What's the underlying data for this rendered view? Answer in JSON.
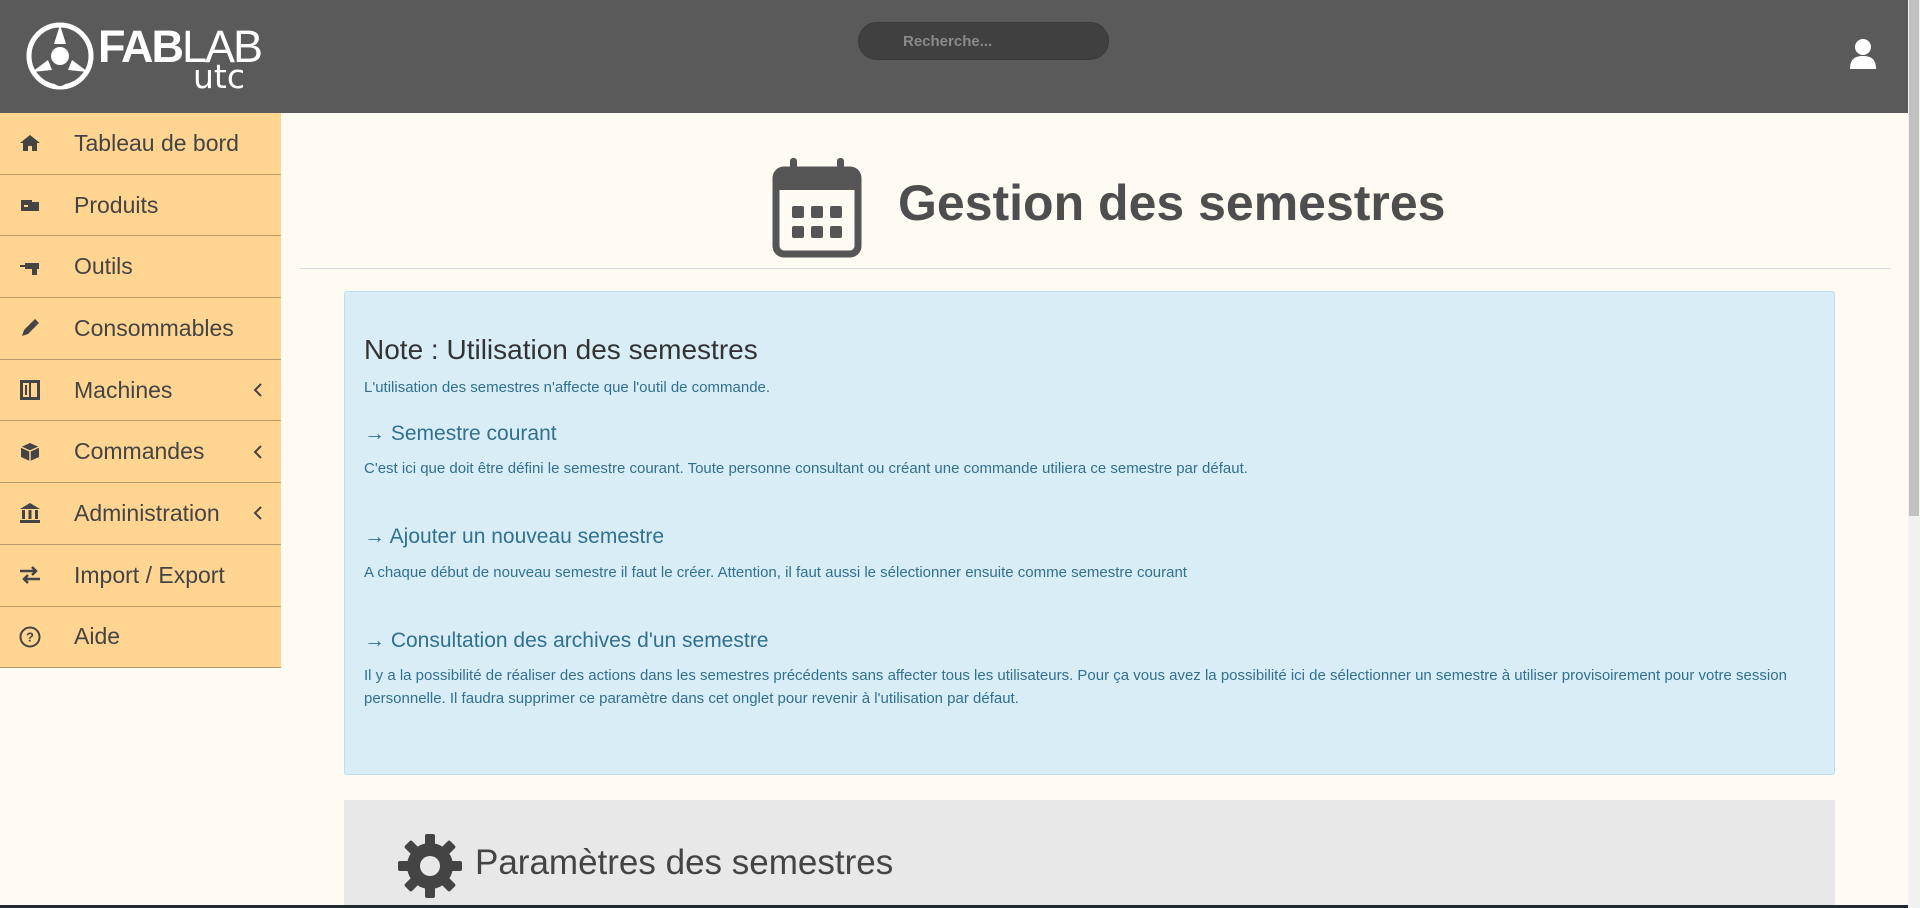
{
  "header": {
    "logo": {
      "brand_bold": "FAB",
      "brand_light": "LAB",
      "sub": "utc"
    },
    "search_placeholder": "Recherche...",
    "user_icon": "user-icon"
  },
  "sidebar": {
    "items": [
      {
        "label": "Tableau de bord",
        "icon": "home-icon",
        "has_submenu": false
      },
      {
        "label": "Produits",
        "icon": "product-icon",
        "has_submenu": false
      },
      {
        "label": "Outils",
        "icon": "drill-icon",
        "has_submenu": false
      },
      {
        "label": "Consommables",
        "icon": "pen-icon",
        "has_submenu": false
      },
      {
        "label": "Machines",
        "icon": "machine-icon",
        "has_submenu": true
      },
      {
        "label": "Commandes",
        "icon": "box-icon",
        "has_submenu": true
      },
      {
        "label": "Administration",
        "icon": "bank-icon",
        "has_submenu": true
      },
      {
        "label": "Import / Export",
        "icon": "exchange-icon",
        "has_submenu": false
      },
      {
        "label": "Aide",
        "icon": "help-icon",
        "has_submenu": false
      }
    ]
  },
  "page": {
    "title": "Gestion des semestres",
    "title_icon": "calendar-icon"
  },
  "note": {
    "title": "Note : Utilisation des semestres",
    "intro": "L'utilisation des semestres n'affecte que l'outil de commande.",
    "sections": [
      {
        "title": "→ Semestre courant",
        "text": "C'est ici que doit être défini le semestre courant. Toute personne consultant ou créant une commande utiliera ce semestre par défaut."
      },
      {
        "title": "→ Ajouter un nouveau semestre",
        "text": "A chaque début de nouveau semestre il faut le créer. Attention, il faut aussi le sélectionner ensuite comme semestre courant"
      },
      {
        "title": "→ Consultation des archives d'un semestre",
        "text": "Il y a la possibilité de réaliser des actions dans les semestres précédents sans affecter tous les utilisateurs. Pour ça vous avez la possibilité ici de sélectionner un semestre à utiliser provisoirement pour votre session personnelle. Il faudra supprimer ce paramètre dans cet onglet pour revenir à l'utilisation par défaut."
      }
    ]
  },
  "params": {
    "title": "Paramètres des semestres",
    "icon": "gear-icon"
  },
  "colors": {
    "topbar": "#5a5a5a",
    "sidebar": "#ffd591",
    "note_bg": "#d9edf7",
    "note_text": "#31708f",
    "page_bg": "#fffbf2"
  }
}
